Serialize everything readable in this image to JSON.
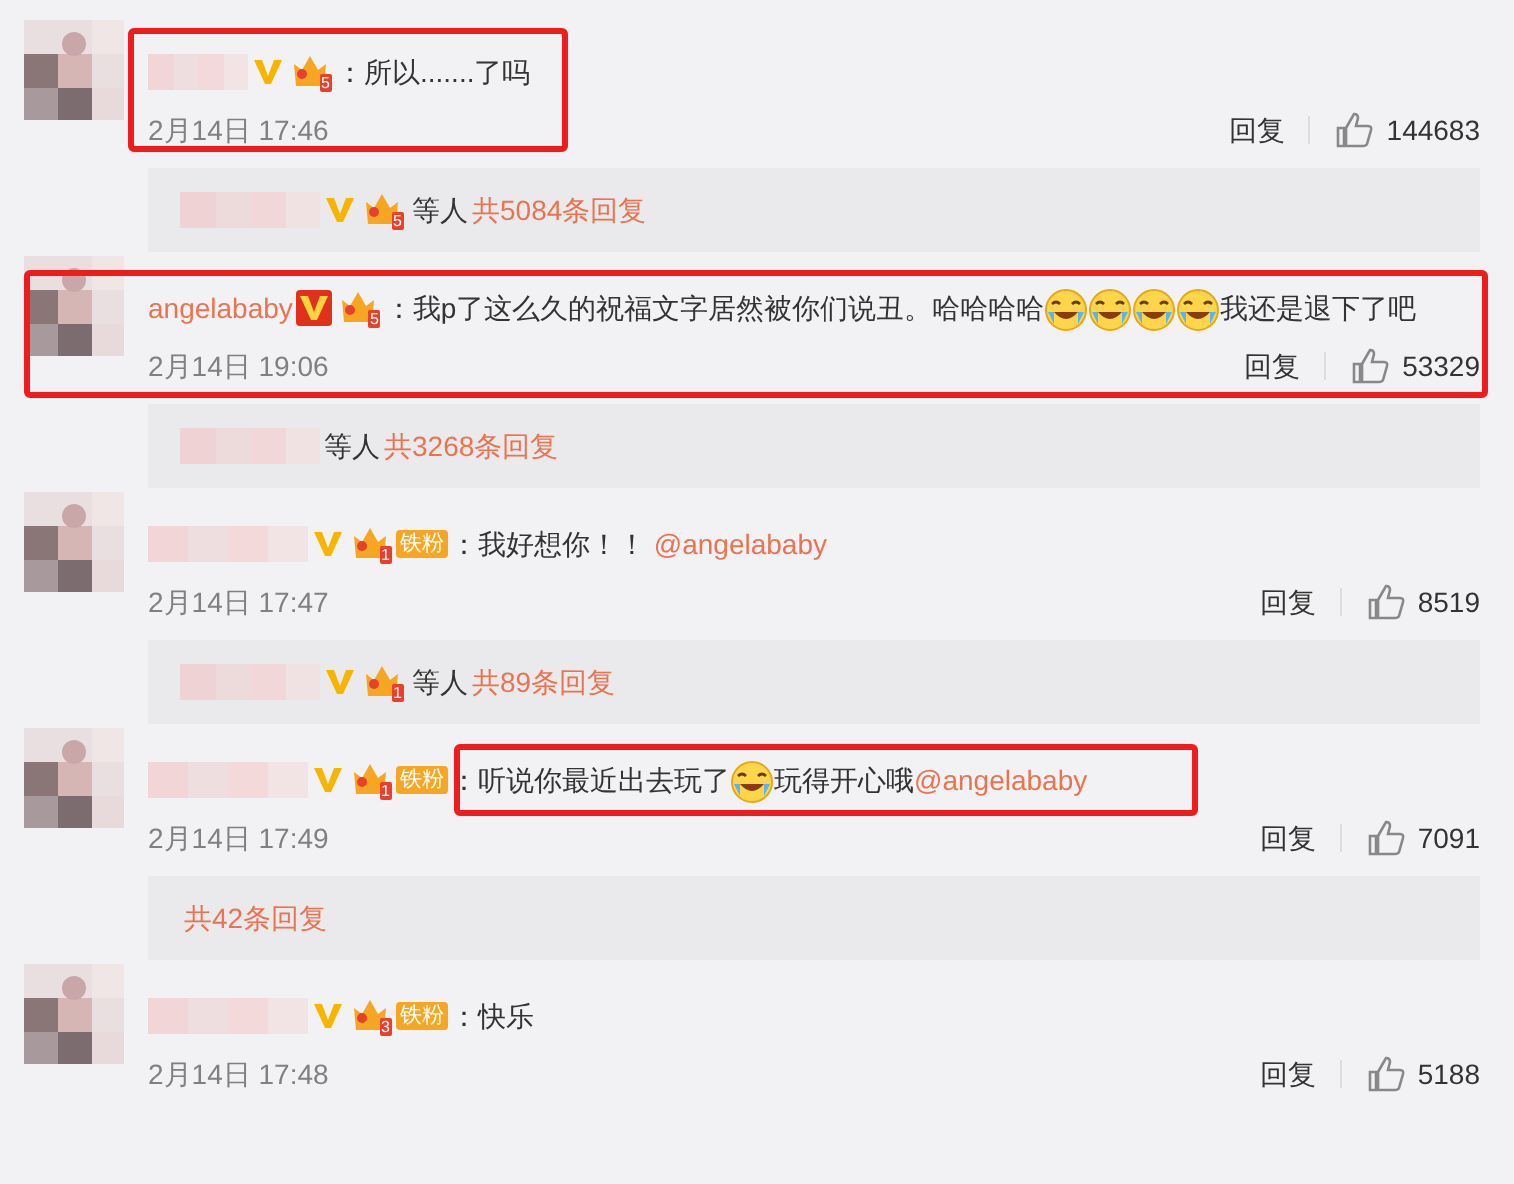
{
  "comments": [
    {
      "verified": true,
      "fan_level": "5",
      "header_annotated": true,
      "text_annotated": false,
      "content": [
        {
          "kind": "text",
          "text": "：所以.......了吗"
        }
      ],
      "time": "2月14日 17:46",
      "reply": "回复",
      "likes": "144683",
      "replies": {
        "verified": true,
        "fan_level": "5",
        "suffix": "等人",
        "count": "共5084条回复"
      }
    },
    {
      "author": "angelababy",
      "verified": true,
      "fan_level": "5",
      "header_annotated": false,
      "text_annotated": true,
      "content": [
        {
          "kind": "text",
          "text": "：我p了这么久的祝福文字居然被你们说丑。哈哈哈哈"
        },
        {
          "kind": "emoji"
        },
        {
          "kind": "emoji"
        },
        {
          "kind": "emoji"
        },
        {
          "kind": "emoji"
        },
        {
          "kind": "text",
          "text": "我还是退下了吧"
        }
      ],
      "time": "2月14日 19:06",
      "reply": "回复",
      "likes": "53329",
      "replies": {
        "verified": false,
        "suffix": "等人",
        "count": "共3268条回复"
      }
    },
    {
      "verified": true,
      "fan_level": "1",
      "fan_badge": "铁粉",
      "header_annotated": false,
      "text_annotated": false,
      "content": [
        {
          "kind": "text",
          "text": "：我好想你！！ "
        },
        {
          "kind": "mention",
          "text": "@angelababy"
        }
      ],
      "time": "2月14日 17:47",
      "reply": "回复",
      "likes": "8519",
      "replies": {
        "verified": true,
        "fan_level": "1",
        "suffix": "等人",
        "count": "共89条回复"
      }
    },
    {
      "verified": true,
      "fan_level": "1",
      "fan_badge": "铁粉",
      "header_annotated": false,
      "text_annotated": true,
      "content": [
        {
          "kind": "text",
          "text": "：听说你最近出去玩了"
        },
        {
          "kind": "emoji"
        },
        {
          "kind": "text",
          "text": "玩得开心哦"
        },
        {
          "kind": "mention",
          "text": "@angelababy"
        }
      ],
      "time": "2月14日 17:49",
      "reply": "回复",
      "likes": "7091",
      "replies": {
        "count": "共42条回复"
      }
    },
    {
      "verified": true,
      "fan_level": "3",
      "fan_badge": "铁粉",
      "header_annotated": false,
      "text_annotated": false,
      "content": [
        {
          "kind": "text",
          "text": "：快乐"
        }
      ],
      "time": "2月14日 17:48",
      "reply": "回复",
      "likes": "5188"
    }
  ]
}
